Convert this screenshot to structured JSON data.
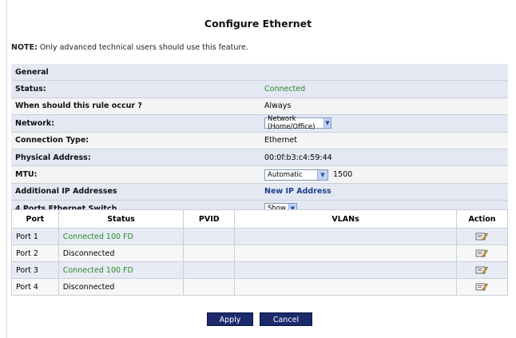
{
  "page": {
    "title": "Configure Ethernet",
    "note_label": "NOTE:",
    "note_text": " Only advanced technical users should use this feature."
  },
  "general": {
    "heading": "General",
    "status_label": "Status:",
    "status_value": "Connected",
    "rule_label": "When should this rule occur ?",
    "rule_value": "Always",
    "network_label": "Network:",
    "network_value": "Network (Home/Office)",
    "conn_type_label": "Connection Type:",
    "conn_type_value": "Ethernet",
    "phys_addr_label": "Physical Address:",
    "phys_addr_value": "00:0f:b3:c4:59:44",
    "mtu_label": "MTU:",
    "mtu_mode": "Automatic",
    "mtu_value": "1500",
    "add_ip_label": "Additional IP Addresses",
    "add_ip_link": "New IP Address",
    "switch_label": "4 Ports Ethernet Switch",
    "switch_value": "Show"
  },
  "ports_table": {
    "headers": {
      "port": "Port",
      "status": "Status",
      "pvid": "PVID",
      "vlans": "VLANs",
      "action": "Action"
    },
    "rows": [
      {
        "port": "Port 1",
        "status": "Connected 100 FD",
        "pvid": "",
        "vlans": ""
      },
      {
        "port": "Port 2",
        "status": "Disconnected",
        "pvid": "",
        "vlans": ""
      },
      {
        "port": "Port 3",
        "status": "Connected 100 FD",
        "pvid": "",
        "vlans": ""
      },
      {
        "port": "Port 4",
        "status": "Disconnected",
        "pvid": "",
        "vlans": ""
      }
    ]
  },
  "buttons": {
    "apply": "Apply",
    "cancel": "Cancel"
  },
  "icons": {
    "select_arrow": "chevron-down-icon",
    "row_action": "edit-icon"
  },
  "colors": {
    "connected": "#2a8a2a",
    "link": "#1f3f8f",
    "button": "#1b2a6b",
    "row_alt": "#e3e8f3"
  }
}
